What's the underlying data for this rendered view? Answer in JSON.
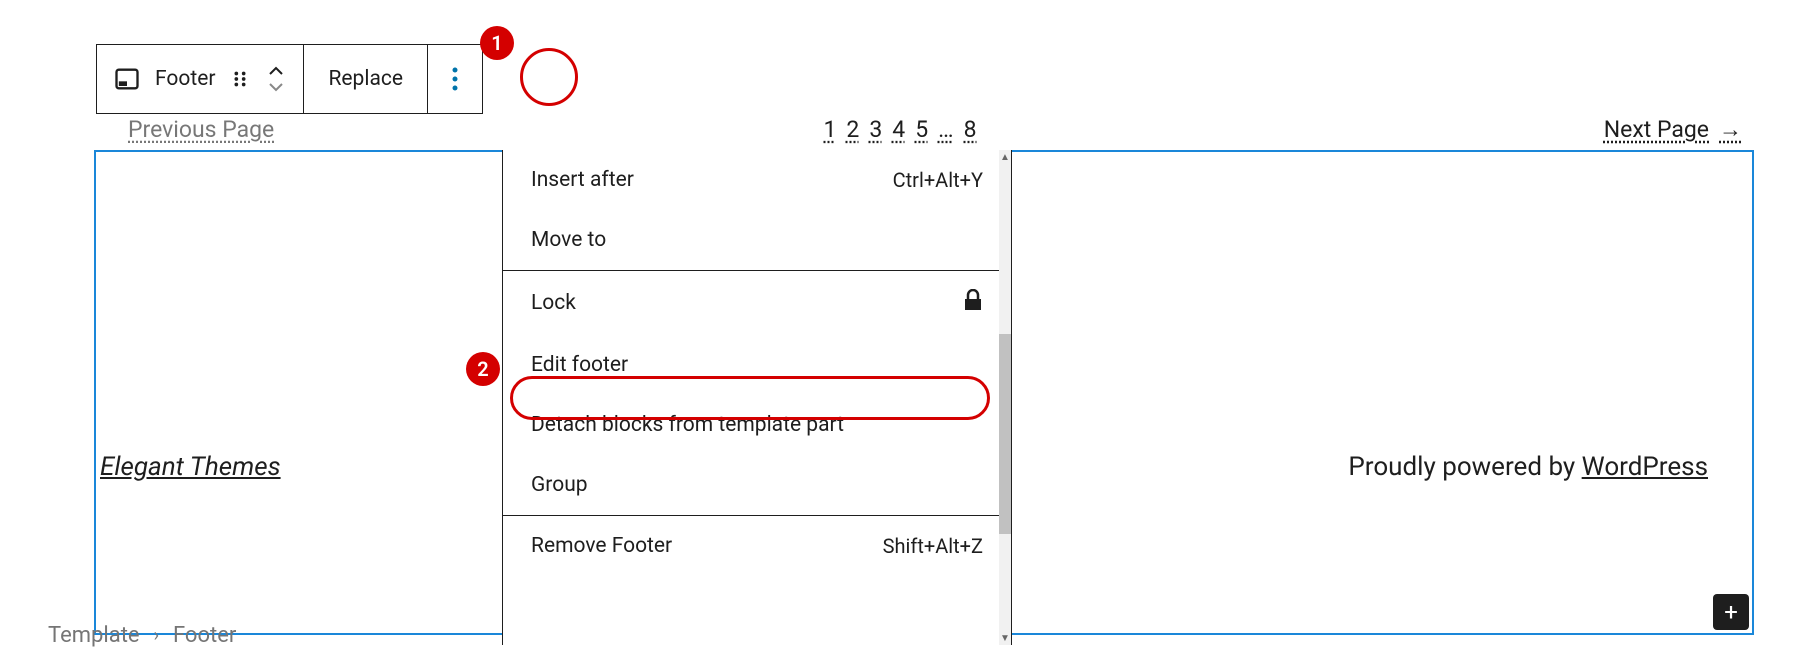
{
  "toolbar": {
    "block_label": "Footer",
    "replace_label": "Replace"
  },
  "callouts": {
    "one": "1",
    "two": "2"
  },
  "pagination": {
    "prev": "Previous Page",
    "next": "Next Page",
    "pages": [
      "1",
      "2",
      "3",
      "4",
      "5"
    ],
    "ellipsis": "…",
    "last": "8"
  },
  "footer": {
    "site_title": "Elegant Themes",
    "credit_prefix": "Proudly powered by ",
    "credit_link": "WordPress"
  },
  "menu": {
    "insert_after": {
      "label": "Insert after",
      "shortcut": "Ctrl+Alt+Y"
    },
    "move_to": {
      "label": "Move to"
    },
    "lock": {
      "label": "Lock"
    },
    "edit_footer": {
      "label": "Edit footer"
    },
    "detach": {
      "label": "Detach blocks from template part"
    },
    "group": {
      "label": "Group"
    },
    "remove": {
      "label": "Remove Footer",
      "shortcut": "Shift+Alt+Z"
    }
  },
  "breadcrumb": {
    "root": "Template",
    "current": "Footer"
  }
}
